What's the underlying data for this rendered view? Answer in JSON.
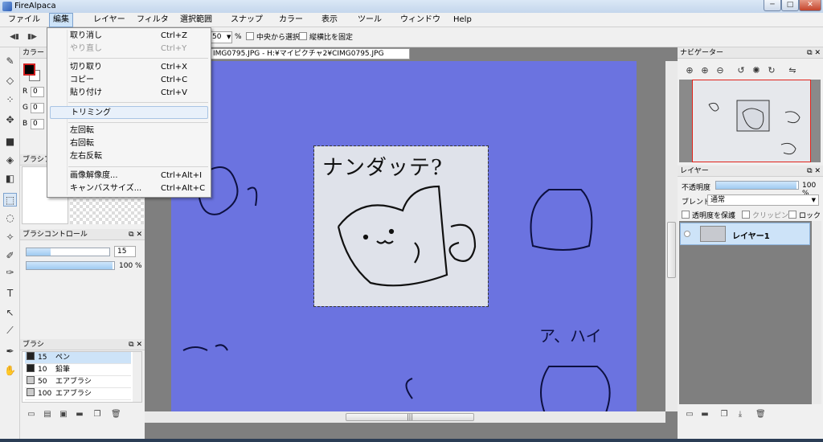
{
  "window": {
    "title": "FireAlpaca",
    "min": "─",
    "max": "□",
    "close": "✕"
  },
  "menubar": [
    {
      "label": "ファイル"
    },
    {
      "label": "編集"
    },
    {
      "label": "レイヤー"
    },
    {
      "label": "フィルタ"
    },
    {
      "label": "選択範囲"
    },
    {
      "label": "スナップ"
    },
    {
      "label": "カラー"
    },
    {
      "label": "表示"
    },
    {
      "label": "ツール"
    },
    {
      "label": "ウィンドウ"
    },
    {
      "label": "Help"
    }
  ],
  "toolbar": {
    "zoom_value": "50",
    "zoom_unit": "%",
    "center_select": "中央から選択",
    "fix_aspect": "縦横比を固定"
  },
  "edit_menu": {
    "items": [
      {
        "label": "取り消し",
        "shortcut": "Ctrl+Z",
        "enabled": true
      },
      {
        "label": "やり直し",
        "shortcut": "Ctrl+Y",
        "enabled": false
      },
      {
        "label": "切り取り",
        "shortcut": "Ctrl+X",
        "enabled": true
      },
      {
        "label": "コピー",
        "shortcut": "Ctrl+C",
        "enabled": true
      },
      {
        "label": "貼り付け",
        "shortcut": "Ctrl+V",
        "enabled": true
      },
      {
        "label": "トリミング",
        "shortcut": "",
        "enabled": true
      },
      {
        "label": "左回転",
        "shortcut": "",
        "enabled": true
      },
      {
        "label": "右回転",
        "shortcut": "",
        "enabled": true
      },
      {
        "label": "左右反転",
        "shortcut": "",
        "enabled": true
      },
      {
        "label": "画像解像度...",
        "shortcut": "Ctrl+Alt+I",
        "enabled": true
      },
      {
        "label": "キャンバスサイズ...",
        "shortcut": "Ctrl+Alt+C",
        "enabled": true
      }
    ]
  },
  "color_panel": {
    "title": "カラー",
    "r_label": "R",
    "r_value": "0",
    "g_label": "G",
    "g_value": "0",
    "b_label": "B",
    "b_value": "0",
    "fg_color": "#000000",
    "bg_color": "#ffffff"
  },
  "brush_preview_panel": {
    "title": "ブラシプレ"
  },
  "brush_control": {
    "title": "ブラシコントロール",
    "size_value": "15",
    "size_fraction": 0.3,
    "opacity_value": "100 %",
    "opacity_fraction": 1.0
  },
  "brush_panel": {
    "title": "ブラシ",
    "items": [
      {
        "size": "15",
        "name": "ペン",
        "selected": true
      },
      {
        "size": "10",
        "name": "鉛筆",
        "selected": false
      },
      {
        "size": "50",
        "name": "エアブラシ",
        "selected": false
      },
      {
        "size": "100",
        "name": "エアブラシ",
        "selected": false
      }
    ]
  },
  "document": {
    "tab_title": "IMG0795.JPG - H:¥マイピクチャ2¥CIMG0795.JPG",
    "canvas_color": "#6b73e0",
    "drawing_text_1": "ナンダッテ?",
    "drawing_text_2": "ア、ハイ"
  },
  "navigator": {
    "title": "ナビゲーター"
  },
  "layer_panel": {
    "title": "レイヤー",
    "opacity_label": "不透明度",
    "opacity_value": "100 %",
    "opacity_fraction": 1.0,
    "blend_label": "ブレンド",
    "blend_value": "通常",
    "protect_alpha": "透明度を保護",
    "clipping": "クリッピング",
    "lock": "ロック",
    "layers": [
      {
        "name": "レイヤー1"
      }
    ]
  },
  "panel_controls": {
    "float": "⧉",
    "close": "✕"
  },
  "accent": "#7da2ce"
}
